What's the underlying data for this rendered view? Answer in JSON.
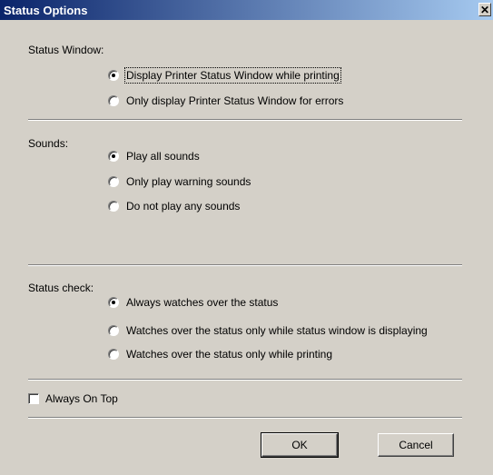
{
  "window": {
    "title": "Status Options",
    "close_glyph": "✕"
  },
  "status_window": {
    "label": "Status Window:",
    "options": [
      {
        "label": "Display Printer Status Window while printing",
        "checked": true
      },
      {
        "label": "Only display Printer Status Window for errors",
        "checked": false
      }
    ]
  },
  "sounds": {
    "label": "Sounds:",
    "options": [
      {
        "label": "Play all sounds",
        "checked": true
      },
      {
        "label": "Only play warning sounds",
        "checked": false
      },
      {
        "label": "Do not play any sounds",
        "checked": false
      }
    ]
  },
  "status_check": {
    "label": "Status check:",
    "options": [
      {
        "label": "Always watches over the status",
        "checked": true
      },
      {
        "label": "Watches over the status only while status window is displaying",
        "checked": false
      },
      {
        "label": "Watches over the status only while printing",
        "checked": false
      }
    ]
  },
  "always_on_top": {
    "label": "Always On Top",
    "checked": false
  },
  "buttons": {
    "ok": "OK",
    "cancel": "Cancel"
  }
}
